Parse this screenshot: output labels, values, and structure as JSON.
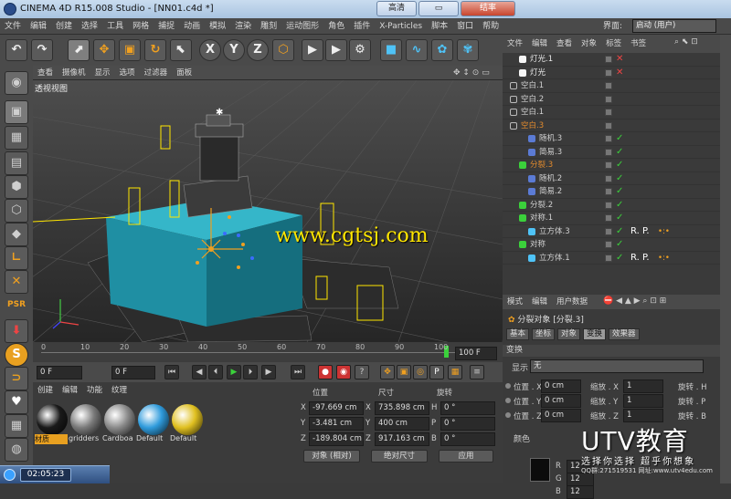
{
  "window": {
    "title": "CINEMA 4D R15.008 Studio - [NN01.c4d *]",
    "btn_a": "高清",
    "btn_b": "",
    "btn_close": "结率"
  },
  "menu": [
    "文件",
    "编辑",
    "创建",
    "选择",
    "工具",
    "网格",
    "捕捉",
    "动画",
    "模拟",
    "渲染",
    "雕刻",
    "运动图形",
    "角色",
    "插件",
    "X-Particles",
    "脚本",
    "窗口",
    "帮助"
  ],
  "layout_label": "界面:",
  "layout_value": "启动 (用户)",
  "toolbar_icons": [
    "undo-icon",
    "redo-icon",
    "live-select-icon",
    "move-icon",
    "scale-icon",
    "rotate-icon",
    "select-icon",
    "x-axis-icon",
    "y-axis-icon",
    "z-axis-icon",
    "world-coords-icon",
    "render-region-icon",
    "render-view-icon",
    "render-settings-icon",
    "cube-icon",
    "pen-icon",
    "subdivision-icon",
    "cloner-icon",
    "deformer-icon"
  ],
  "toolbar_letters": {
    "x": "X",
    "y": "Y",
    "z": "Z"
  },
  "viewport": {
    "menu": [
      "查看",
      "摄像机",
      "显示",
      "选项",
      "过滤器",
      "面板"
    ],
    "label": "透视视图",
    "watermark": "www.cgtsj.com"
  },
  "timeline": {
    "ticks": [
      "0",
      "10",
      "20",
      "30",
      "40",
      "50",
      "60",
      "70",
      "80",
      "90",
      "100"
    ],
    "end_field": "100 F"
  },
  "transport": {
    "start": "0 F",
    "current": "0 F",
    "end": "100 F"
  },
  "materials": {
    "menu": [
      "创建",
      "编辑",
      "功能",
      "纹理"
    ],
    "items": [
      {
        "label": "材质",
        "color": "#1a1a1a"
      },
      {
        "label": "gridders",
        "color": "#7a7a7a"
      },
      {
        "label": "Cardboa",
        "color": "#8a8a8a"
      },
      {
        "label": "Default",
        "color": "#2f9bdc"
      },
      {
        "label": "Default",
        "color": "#e0c020"
      }
    ]
  },
  "coords": {
    "headers": [
      "位置",
      "尺寸",
      "旋转"
    ],
    "rows": [
      {
        "axis": "X",
        "pos": "-97.669 cm",
        "size_axis": "X",
        "size": "735.898 cm",
        "rot_axis": "H",
        "rot": "0 °"
      },
      {
        "axis": "Y",
        "pos": "-3.481 cm",
        "size_axis": "Y",
        "size": "400 cm",
        "rot_axis": "P",
        "rot": "0 °"
      },
      {
        "axis": "Z",
        "pos": "-189.804 cm",
        "size_axis": "Z",
        "size": "917.163 cm",
        "rot_axis": "B",
        "rot": "0 °"
      }
    ],
    "mode": "对象 (相对)",
    "size_mode": "绝对尺寸",
    "apply": "应用"
  },
  "objects": {
    "menu": [
      "文件",
      "编辑",
      "查看",
      "对象",
      "标签",
      "书签"
    ],
    "rows": [
      {
        "name": "灯光.1",
        "indent": 1,
        "icon": "light-icon",
        "color": "#e8e8e8",
        "check": "red"
      },
      {
        "name": "灯光",
        "indent": 1,
        "icon": "light-icon",
        "color": "#e8e8e8",
        "check": "red"
      },
      {
        "name": "空白.1",
        "indent": 0,
        "icon": "null-icon",
        "color": "#d0d0d0",
        "check": "none"
      },
      {
        "name": "空白.2",
        "indent": 0,
        "icon": "null-icon",
        "color": "#d0d0d0",
        "check": "none"
      },
      {
        "name": "空白.1",
        "indent": 0,
        "icon": "null-icon",
        "color": "#d0d0d0",
        "check": "none"
      },
      {
        "name": "空白.3",
        "indent": 0,
        "icon": "null-icon",
        "color": "#e38b2d",
        "check": "none"
      },
      {
        "name": "随机.3",
        "indent": 2,
        "icon": "effector-icon",
        "color": "#d0d0d0",
        "check": "green"
      },
      {
        "name": "简易.3",
        "indent": 2,
        "icon": "effector-icon",
        "color": "#d0d0d0",
        "check": "green"
      },
      {
        "name": "分裂.3",
        "indent": 1,
        "icon": "fracture-icon",
        "color": "#e38b2d",
        "check": "green"
      },
      {
        "name": "随机.2",
        "indent": 2,
        "icon": "effector-icon",
        "color": "#d0d0d0",
        "check": "green"
      },
      {
        "name": "简易.2",
        "indent": 2,
        "icon": "effector-icon",
        "color": "#d0d0d0",
        "check": "green"
      },
      {
        "name": "分裂.2",
        "indent": 1,
        "icon": "fracture-icon",
        "color": "#d0d0d0",
        "check": "green"
      },
      {
        "name": "对称.1",
        "indent": 1,
        "icon": "symmetry-icon",
        "color": "#d0d0d0",
        "check": "green"
      },
      {
        "name": "立方体.3",
        "indent": 2,
        "icon": "cube-icon",
        "color": "#d0d0d0",
        "check": "green",
        "tags": "R. P."
      },
      {
        "name": "对称",
        "indent": 1,
        "icon": "symmetry-icon",
        "color": "#d0d0d0",
        "check": "green"
      },
      {
        "name": "立方体.1",
        "indent": 2,
        "icon": "cube-icon",
        "color": "#d0d0d0",
        "check": "green",
        "tags": "R. P."
      }
    ]
  },
  "attributes": {
    "menu": [
      "模式",
      "编辑",
      "用户数据"
    ],
    "title": "分裂对象 [分裂.3]",
    "tabs": [
      "基本",
      "坐标",
      "对象",
      "变换",
      "效果器"
    ],
    "active_tab": "变换",
    "section": "变换",
    "display_label": "显示",
    "display_value": "无",
    "rows": [
      {
        "label": "位置 . X",
        "value": "0 cm",
        "label2": "缩放 . X",
        "value2": "1",
        "label3": "旋转 . H"
      },
      {
        "label": "位置 . Y",
        "value": "0 cm",
        "label2": "缩放 . Y",
        "value2": "1",
        "label3": "旋转 . P"
      },
      {
        "label": "位置 . Z",
        "value": "0 cm",
        "label2": "缩放 . Z",
        "value2": "1",
        "label3": "旋转 . B"
      }
    ],
    "color_label": "颜色",
    "rgb": [
      "R",
      "G",
      "B"
    ],
    "rgb_values": [
      "12",
      "12",
      "12"
    ]
  },
  "branding": {
    "logo": "UTV教育",
    "slogan": "选择你选择 超乎你想象",
    "qq": "QQ群:271519531  网址:www.utv4edu.com"
  },
  "clock": "02:05:23",
  "colors": {
    "accent": "#e8a020",
    "teal": "#1f8fa3",
    "selection": "#ffe600"
  }
}
